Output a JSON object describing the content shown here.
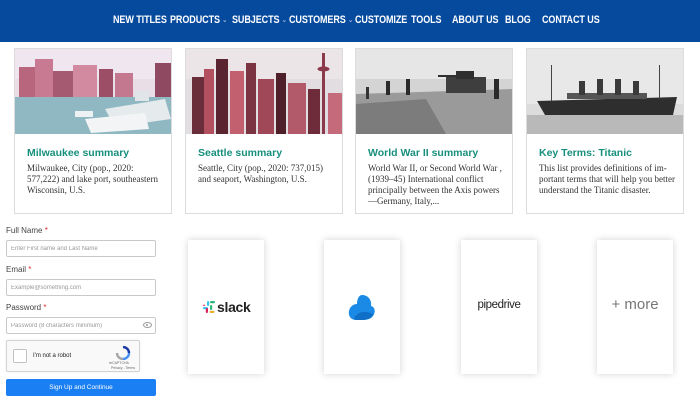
{
  "nav": {
    "items": [
      {
        "label": "NEW TITLES",
        "caret": false
      },
      {
        "label": "PRODUCTS",
        "caret": true
      },
      {
        "label": "SUBJECTS",
        "caret": true
      },
      {
        "label": "CUSTOMERS",
        "caret": true
      },
      {
        "label": "CUSTOMIZE",
        "caret": false
      },
      {
        "label": "TOOLS",
        "caret": false
      },
      {
        "label": "ABOUT US",
        "caret": false
      },
      {
        "label": "BLOG",
        "caret": false
      },
      {
        "label": "CONTACT US",
        "caret": false
      }
    ],
    "caret_glyph": "⌄",
    "background": "#064a9e"
  },
  "cards": [
    {
      "title": "Milwaukee summary",
      "text": "Milwaukee, City (pop., 2020: 577,222) and lake port, southeast­ern Wisconsin, U.S."
    },
    {
      "title": "Seattle summary",
      "text": "Seattle, City (pop., 2020: 737,015) and seaport, Washington, U.S."
    },
    {
      "title": "World War II summary",
      "text": "World War II, or Second World War , (1939–45) International con­flict principally between the Axis powers—Germany, Italy,..."
    },
    {
      "title": "Key Terms: Titanic",
      "text": "This list provides definitions of im­portant terms that will help you better understand the Titanic disaster."
    }
  ],
  "form": {
    "full_name": {
      "label": "Full Name",
      "required": "*",
      "placeholder": "Enter First name and Last Name"
    },
    "email": {
      "label": "Email",
      "required": "*",
      "placeholder": "Example@something.com"
    },
    "password": {
      "label": "Password",
      "required": "*",
      "placeholder": "Password (8 characters minimum)"
    },
    "captcha": {
      "label": "I'm not a robot",
      "brand": "reCAPTCHA",
      "links": "Privacy - Terms"
    },
    "submit_label": "Sign Up and Continue"
  },
  "integrations": [
    {
      "name": "slack",
      "icon": "slack-logo-icon"
    },
    {
      "name": "",
      "icon": "cloud-logo-icon"
    },
    {
      "name": "pipedrive",
      "icon": "pipedrive-logo"
    },
    {
      "name": "+ more",
      "icon": "more-label"
    }
  ],
  "colors": {
    "accent_title": "#178f7d",
    "submit_button": "#1a7ff2"
  }
}
